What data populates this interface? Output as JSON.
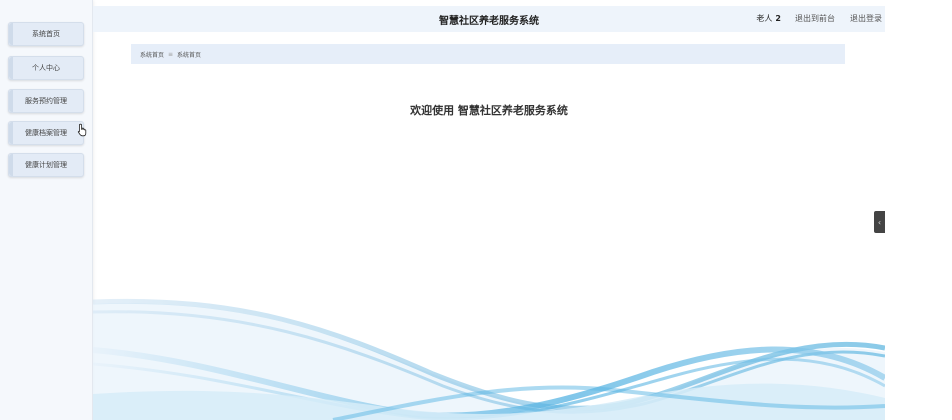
{
  "header": {
    "title": "智慧社区养老服务系统",
    "user_label": "老人",
    "user_number": "2",
    "exit_to_frontend": "退出到前台",
    "logout": "退出登录"
  },
  "sidebar": {
    "items": [
      {
        "label": "系统首页"
      },
      {
        "label": "个人中心"
      },
      {
        "label": "服务预约管理"
      },
      {
        "label": "健康档案管理"
      },
      {
        "label": "健康计划管理"
      }
    ]
  },
  "breadcrumb": {
    "root": "系统首页",
    "separator": "≡",
    "current": "系统首页"
  },
  "main": {
    "welcome": "欢迎使用 智慧社区养老服务系统"
  },
  "collapse_handle": {
    "glyph": "‹"
  },
  "colors": {
    "sidebar_bg": "#f5f8fc",
    "menu_item_bg": "#e3ebf6",
    "topbar_bg": "#eef4fb",
    "wave_accent": "#2a9fd6"
  }
}
